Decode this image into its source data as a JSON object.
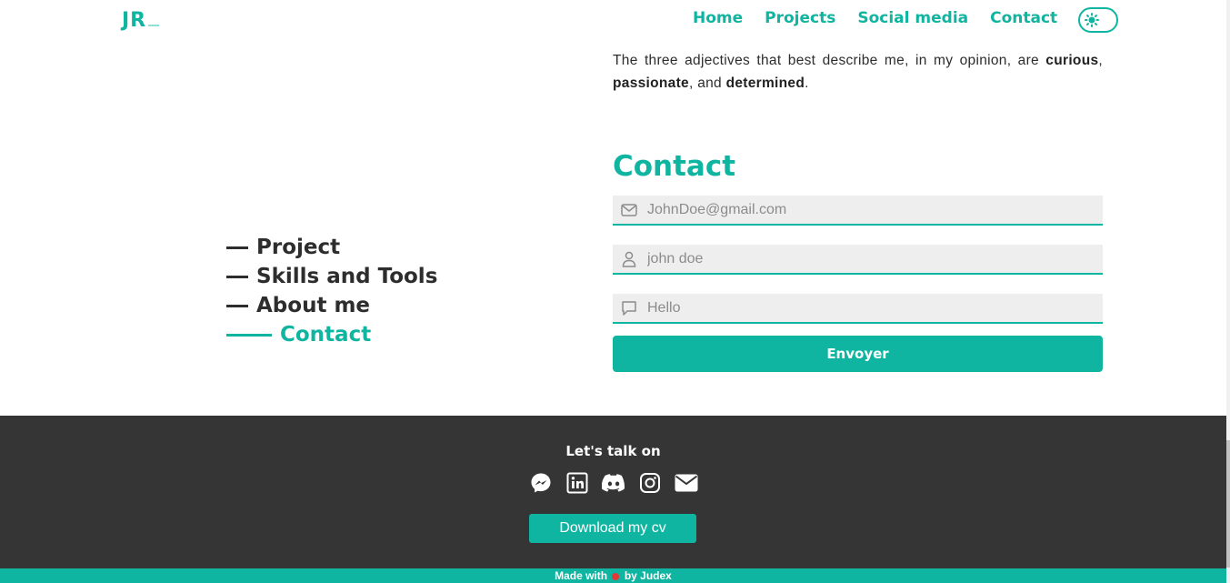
{
  "header": {
    "logo": "JR",
    "nav": [
      "Home",
      "Projects",
      "Social media",
      "Contact"
    ]
  },
  "about": {
    "part1": "The three adjectives that best describe me, in my opinion, are ",
    "adj1": "curious",
    "sep1": ", ",
    "adj2": "passionate",
    "sep2": ", and ",
    "adj3": "determined",
    "end": "."
  },
  "sections": {
    "items": [
      "Project",
      "Skills and Tools",
      "About me",
      "Contact"
    ],
    "active": "Contact"
  },
  "contact": {
    "title": "Contact",
    "email_placeholder": "JohnDoe@gmail.com",
    "name_placeholder": "john doe",
    "message_placeholder": "Hello",
    "submit_label": "Envoyer"
  },
  "footer": {
    "title": "Let's talk on",
    "socials": [
      "messenger-icon",
      "linkedin-icon",
      "discord-icon",
      "instagram-icon",
      "mail-icon"
    ],
    "cv_label": "Download my cv",
    "made_with": "Made with",
    "by": "by Judex"
  },
  "colors": {
    "accent": "#0fb5a0",
    "dark": "#353535",
    "text": "#2d2d2d"
  }
}
